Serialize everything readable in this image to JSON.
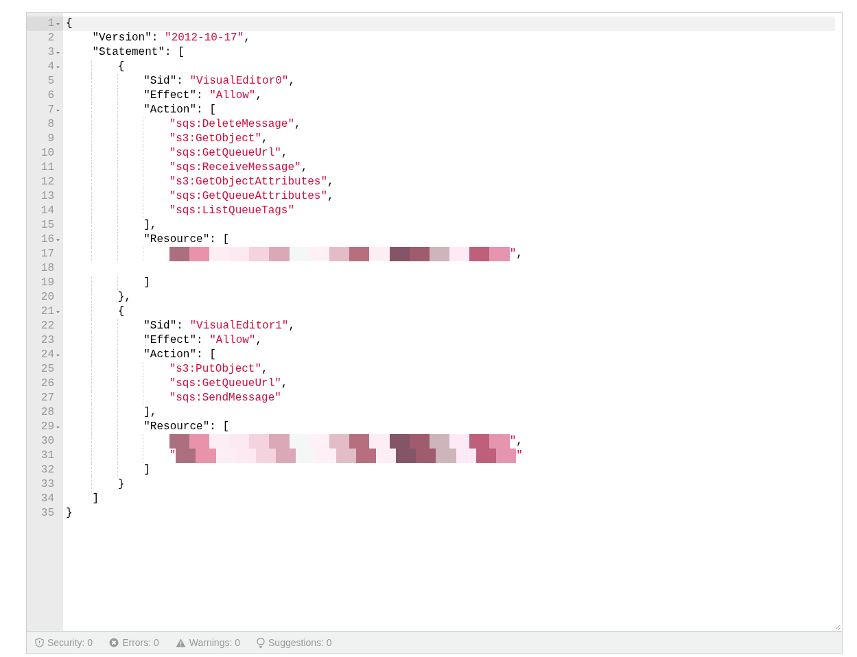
{
  "editor": {
    "lines": [
      {
        "number": "1",
        "foldable": true,
        "active": true,
        "tokens": [
          {
            "kind": "punct",
            "text": "{"
          }
        ],
        "children": [
          {
            "number": "2",
            "foldable": false,
            "active": false,
            "tokens": [
              {
                "kind": "key",
                "text": "\"Version\""
              },
              {
                "kind": "punct",
                "text": ": "
              },
              {
                "kind": "string",
                "text": "\"2012-10-17\""
              },
              {
                "kind": "punct",
                "text": ","
              }
            ]
          },
          {
            "number": "3",
            "foldable": true,
            "active": false,
            "tokens": [
              {
                "kind": "key",
                "text": "\"Statement\""
              },
              {
                "kind": "punct",
                "text": ": ["
              }
            ],
            "children": [
              {
                "number": "4",
                "foldable": true,
                "active": false,
                "tokens": [
                  {
                    "kind": "punct",
                    "text": "{"
                  }
                ],
                "children": [
                  {
                    "number": "5",
                    "foldable": false,
                    "active": false,
                    "tokens": [
                      {
                        "kind": "key",
                        "text": "\"Sid\""
                      },
                      {
                        "kind": "punct",
                        "text": ": "
                      },
                      {
                        "kind": "string",
                        "text": "\"VisualEditor0\""
                      },
                      {
                        "kind": "punct",
                        "text": ","
                      }
                    ]
                  },
                  {
                    "number": "6",
                    "foldable": false,
                    "active": false,
                    "tokens": [
                      {
                        "kind": "key",
                        "text": "\"Effect\""
                      },
                      {
                        "kind": "punct",
                        "text": ": "
                      },
                      {
                        "kind": "string",
                        "text": "\"Allow\""
                      },
                      {
                        "kind": "punct",
                        "text": ","
                      }
                    ]
                  },
                  {
                    "number": "7",
                    "foldable": true,
                    "active": false,
                    "tokens": [
                      {
                        "kind": "key",
                        "text": "\"Action\""
                      },
                      {
                        "kind": "punct",
                        "text": ": ["
                      }
                    ],
                    "children": [
                      {
                        "number": "8",
                        "foldable": false,
                        "active": false,
                        "tokens": [
                          {
                            "kind": "string",
                            "text": "\"sqs:DeleteMessage\""
                          },
                          {
                            "kind": "punct",
                            "text": ","
                          }
                        ]
                      },
                      {
                        "number": "9",
                        "foldable": false,
                        "active": false,
                        "tokens": [
                          {
                            "kind": "string",
                            "text": "\"s3:GetObject\""
                          },
                          {
                            "kind": "punct",
                            "text": ","
                          }
                        ]
                      },
                      {
                        "number": "10",
                        "foldable": false,
                        "active": false,
                        "tokens": [
                          {
                            "kind": "string",
                            "text": "\"sqs:GetQueueUrl\""
                          },
                          {
                            "kind": "punct",
                            "text": ","
                          }
                        ]
                      },
                      {
                        "number": "11",
                        "foldable": false,
                        "active": false,
                        "tokens": [
                          {
                            "kind": "string",
                            "text": "\"sqs:ReceiveMessage\""
                          },
                          {
                            "kind": "punct",
                            "text": ","
                          }
                        ]
                      },
                      {
                        "number": "12",
                        "foldable": false,
                        "active": false,
                        "tokens": [
                          {
                            "kind": "string",
                            "text": "\"s3:GetObjectAttributes\""
                          },
                          {
                            "kind": "punct",
                            "text": ","
                          }
                        ]
                      },
                      {
                        "number": "13",
                        "foldable": false,
                        "active": false,
                        "tokens": [
                          {
                            "kind": "string",
                            "text": "\"sqs:GetQueueAttributes\""
                          },
                          {
                            "kind": "punct",
                            "text": ","
                          }
                        ]
                      },
                      {
                        "number": "14",
                        "foldable": false,
                        "active": false,
                        "tokens": [
                          {
                            "kind": "string",
                            "text": "\"sqs:ListQueueTags\""
                          }
                        ]
                      }
                    ]
                  },
                  {
                    "number": "15",
                    "foldable": false,
                    "active": false,
                    "tokens": [
                      {
                        "kind": "punct",
                        "text": "],"
                      }
                    ]
                  },
                  {
                    "number": "16",
                    "foldable": true,
                    "active": false,
                    "tokens": [
                      {
                        "kind": "key",
                        "text": "\"Resource\""
                      },
                      {
                        "kind": "punct",
                        "text": ": ["
                      }
                    ],
                    "children": [
                      {
                        "number": "17",
                        "foldable": false,
                        "active": false,
                        "tokens": [
                          {
                            "kind": "redaction"
                          },
                          {
                            "kind": "string",
                            "text": "\""
                          },
                          {
                            "kind": "punct",
                            "text": ","
                          }
                        ]
                      },
                      {
                        "number": "18",
                        "foldable": false,
                        "active": false
                      }
                    ]
                  },
                  {
                    "number": "19",
                    "foldable": false,
                    "active": false,
                    "tokens": [
                      {
                        "kind": "punct",
                        "text": "]"
                      }
                    ]
                  }
                ]
              },
              {
                "number": "20",
                "foldable": false,
                "active": false,
                "tokens": [
                  {
                    "kind": "punct",
                    "text": "},"
                  }
                ]
              },
              {
                "number": "21",
                "foldable": true,
                "active": false,
                "tokens": [
                  {
                    "kind": "punct",
                    "text": "{"
                  }
                ],
                "children": [
                  {
                    "number": "22",
                    "foldable": false,
                    "active": false,
                    "tokens": [
                      {
                        "kind": "key",
                        "text": "\"Sid\""
                      },
                      {
                        "kind": "punct",
                        "text": ": "
                      },
                      {
                        "kind": "string",
                        "text": "\"VisualEditor1\""
                      },
                      {
                        "kind": "punct",
                        "text": ","
                      }
                    ]
                  },
                  {
                    "number": "23",
                    "foldable": false,
                    "active": false,
                    "tokens": [
                      {
                        "kind": "key",
                        "text": "\"Effect\""
                      },
                      {
                        "kind": "punct",
                        "text": ": "
                      },
                      {
                        "kind": "string",
                        "text": "\"Allow\""
                      },
                      {
                        "kind": "punct",
                        "text": ","
                      }
                    ]
                  },
                  {
                    "number": "24",
                    "foldable": true,
                    "active": false,
                    "tokens": [
                      {
                        "kind": "key",
                        "text": "\"Action\""
                      },
                      {
                        "kind": "punct",
                        "text": ": ["
                      }
                    ],
                    "children": [
                      {
                        "number": "25",
                        "foldable": false,
                        "active": false,
                        "tokens": [
                          {
                            "kind": "string",
                            "text": "\"s3:PutObject\""
                          },
                          {
                            "kind": "punct",
                            "text": ","
                          }
                        ]
                      },
                      {
                        "number": "26",
                        "foldable": false,
                        "active": false,
                        "tokens": [
                          {
                            "kind": "string",
                            "text": "\"sqs:GetQueueUrl\""
                          },
                          {
                            "kind": "punct",
                            "text": ","
                          }
                        ]
                      },
                      {
                        "number": "27",
                        "foldable": false,
                        "active": false,
                        "tokens": [
                          {
                            "kind": "string",
                            "text": "\"sqs:SendMessage\""
                          }
                        ]
                      }
                    ]
                  },
                  {
                    "number": "28",
                    "foldable": false,
                    "active": false,
                    "tokens": [
                      {
                        "kind": "punct",
                        "text": "],"
                      }
                    ]
                  },
                  {
                    "number": "29",
                    "foldable": true,
                    "active": false,
                    "tokens": [
                      {
                        "kind": "key",
                        "text": "\"Resource\""
                      },
                      {
                        "kind": "punct",
                        "text": ": ["
                      }
                    ],
                    "children": [
                      {
                        "number": "30",
                        "foldable": false,
                        "active": false,
                        "tokens": [
                          {
                            "kind": "redaction"
                          },
                          {
                            "kind": "string",
                            "text": "\""
                          },
                          {
                            "kind": "punct",
                            "text": ","
                          }
                        ]
                      },
                      {
                        "number": "31",
                        "foldable": false,
                        "active": false,
                        "tokens": [
                          {
                            "kind": "string",
                            "text": "\""
                          },
                          {
                            "kind": "redaction"
                          },
                          {
                            "kind": "string",
                            "text": "\""
                          }
                        ]
                      }
                    ]
                  },
                  {
                    "number": "32",
                    "foldable": false,
                    "active": false,
                    "tokens": [
                      {
                        "kind": "punct",
                        "text": "]"
                      }
                    ]
                  }
                ]
              },
              {
                "number": "33",
                "foldable": false,
                "active": false,
                "tokens": [
                  {
                    "kind": "punct",
                    "text": "}"
                  }
                ]
              }
            ]
          },
          {
            "number": "34",
            "foldable": false,
            "active": false,
            "tokens": [
              {
                "kind": "punct",
                "text": "]"
              }
            ]
          }
        ]
      },
      {
        "number": "35",
        "foldable": false,
        "active": false,
        "tokens": [
          {
            "kind": "punct",
            "text": "}"
          }
        ]
      }
    ]
  },
  "status_bar": [
    {
      "kind": "security",
      "label": "Security: 0"
    },
    {
      "kind": "errors",
      "label": "Errors: 0"
    },
    {
      "kind": "warnings",
      "label": "Warnings: 0"
    },
    {
      "kind": "suggestions",
      "label": "Suggestions: 0"
    }
  ]
}
